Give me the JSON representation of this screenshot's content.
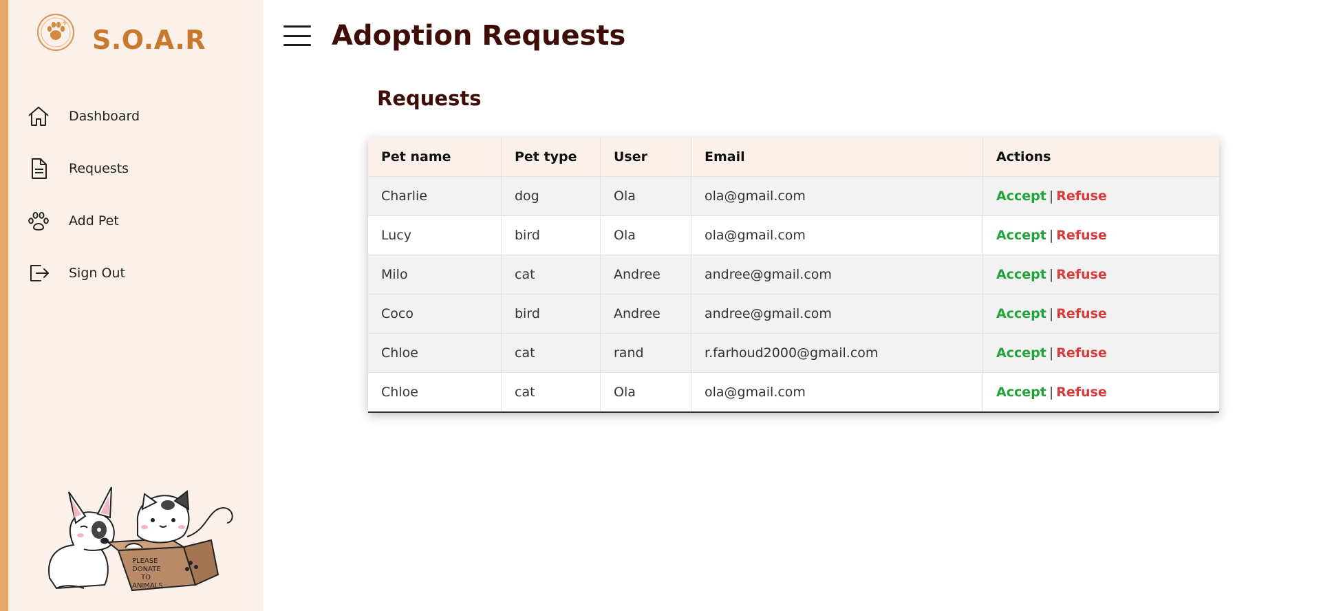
{
  "app": {
    "logo_text": "S.O.A.R"
  },
  "sidebar": {
    "items": [
      {
        "label": "Dashboard",
        "icon": "home-icon"
      },
      {
        "label": "Requests",
        "icon": "document-icon"
      },
      {
        "label": "Add Pet",
        "icon": "paw-icon"
      },
      {
        "label": "Sign Out",
        "icon": "sign-out-icon"
      }
    ],
    "mascot_text": "PLEASE DONATE TO ANIMALS"
  },
  "header": {
    "title": "Adoption Requests"
  },
  "main": {
    "section_title": "Requests",
    "table": {
      "columns": [
        "Pet name",
        "Pet type",
        "User",
        "Email",
        "Actions"
      ],
      "rows": [
        {
          "pet_name": "Charlie",
          "pet_type": "dog",
          "user": "Ola",
          "email": "ola@gmail.com",
          "accept": "Accept",
          "sep": "|",
          "refuse": "Refuse"
        },
        {
          "pet_name": "Lucy",
          "pet_type": "bird",
          "user": "Ola",
          "email": "ola@gmail.com",
          "accept": "Accept",
          "sep": "|",
          "refuse": "Refuse"
        },
        {
          "pet_name": "Milo",
          "pet_type": "cat",
          "user": "Andree",
          "email": "andree@gmail.com",
          "accept": "Accept",
          "sep": "|",
          "refuse": "Refuse"
        },
        {
          "pet_name": "Coco",
          "pet_type": "bird",
          "user": "Andree",
          "email": "andree@gmail.com",
          "accept": "Accept",
          "sep": "|",
          "refuse": "Refuse"
        },
        {
          "pet_name": "Chloe",
          "pet_type": "cat",
          "user": "rand",
          "email": "r.farhoud2000@gmail.com",
          "accept": "Accept",
          "sep": "|",
          "refuse": "Refuse"
        },
        {
          "pet_name": "Chloe",
          "pet_type": "cat",
          "user": "Ola",
          "email": "ola@gmail.com",
          "accept": "Accept",
          "sep": "|",
          "refuse": "Refuse"
        }
      ]
    }
  },
  "colors": {
    "accent_strip": "#e4a86a",
    "sidebar_bg": "#fbf1ea",
    "brand": "#c9792b",
    "title": "#3f0d07",
    "accept": "#21a33a",
    "refuse": "#d63a3a"
  }
}
